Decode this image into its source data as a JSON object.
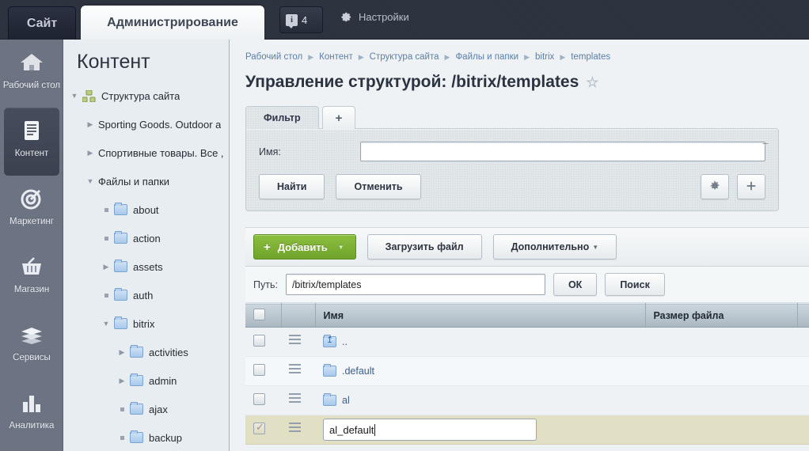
{
  "topbar": {
    "site_tab": "Сайт",
    "admin_tab": "Администрирование",
    "notifications_count": "4",
    "notifications_icon": "info-bubble-icon",
    "settings_label": "Настройки",
    "settings_icon": "gear-icon"
  },
  "rail": {
    "items": [
      {
        "label": "Рабочий стол",
        "icon": "home-icon",
        "active": false
      },
      {
        "label": "Контент",
        "icon": "document-icon",
        "active": true
      },
      {
        "label": "Маркетинг",
        "icon": "target-icon",
        "active": false
      },
      {
        "label": "Магазин",
        "icon": "basket-icon",
        "active": false
      },
      {
        "label": "Сервисы",
        "icon": "layers-icon",
        "active": false
      },
      {
        "label": "Аналитика",
        "icon": "bar-chart-icon",
        "active": false
      }
    ]
  },
  "tree": {
    "title": "Контент",
    "nodes": [
      {
        "label": "Структура сайта",
        "twist": "▼",
        "type": "sitemap",
        "indent": 0
      },
      {
        "label": "Sporting Goods. Outdoor a",
        "twist": "▶",
        "type": "none",
        "indent": 1
      },
      {
        "label": "Спортивные товары. Все ,",
        "twist": "▶",
        "type": "none",
        "indent": 1
      },
      {
        "label": "Файлы и папки",
        "twist": "▼",
        "type": "none",
        "indent": 1
      },
      {
        "label": "about",
        "twist": "bullet",
        "type": "folder",
        "indent": 2
      },
      {
        "label": "action",
        "twist": "bullet",
        "type": "folder",
        "indent": 2
      },
      {
        "label": "assets",
        "twist": "▶",
        "type": "folder",
        "indent": 2
      },
      {
        "label": "auth",
        "twist": "bullet",
        "type": "folder",
        "indent": 2
      },
      {
        "label": "bitrix",
        "twist": "▼",
        "type": "folder",
        "indent": 2
      },
      {
        "label": "activities",
        "twist": "▶",
        "type": "folder",
        "indent": 3
      },
      {
        "label": "admin",
        "twist": "▶",
        "type": "folder",
        "indent": 3
      },
      {
        "label": "ajax",
        "twist": "bullet",
        "type": "folder",
        "indent": 3
      },
      {
        "label": "backup",
        "twist": "bullet",
        "type": "folder",
        "indent": 3
      }
    ]
  },
  "breadcrumb": {
    "items": [
      "Рабочий стол",
      "Контент",
      "Структура сайта",
      "Файлы и папки",
      "bitrix",
      "templates"
    ],
    "separator": "▶"
  },
  "page": {
    "title": "Управление структурой: /bitrix/templates",
    "star_icon": "star-outline-icon"
  },
  "filter": {
    "tab_label": "Фильтр",
    "add_tab_label": "+",
    "collapse_label": "−",
    "name_label": "Имя:",
    "name_value": "",
    "find_button": "Найти",
    "cancel_button": "Отменить",
    "settings_icon": "gear-icon",
    "add_icon": "plus-icon"
  },
  "toolbar": {
    "add_label": "Добавить",
    "add_plus": "+",
    "upload_label": "Загрузить файл",
    "more_label": "Дополнительно",
    "caret": "▼"
  },
  "pathbar": {
    "label": "Путь:",
    "value": "/bitrix/templates",
    "ok_button": "ОК",
    "search_button": "Поиск"
  },
  "table": {
    "columns": [
      "",
      "",
      "Имя",
      "Размер файла"
    ],
    "rows": [
      {
        "name": "..",
        "icon": "folder-up-icon",
        "size": "",
        "checked": false,
        "editing": false,
        "alt": false
      },
      {
        "name": ".default",
        "icon": "folder-icon",
        "size": "",
        "checked": false,
        "editing": false,
        "alt": true
      },
      {
        "name": "al",
        "icon": "folder-icon",
        "size": "",
        "checked": false,
        "editing": false,
        "alt": false
      },
      {
        "name": "al_default",
        "icon": "",
        "size": "",
        "checked": true,
        "editing": true,
        "alt": false
      }
    ]
  },
  "colors": {
    "accent_green": "#7fb335",
    "selected_row": "#e2e0c4",
    "link_blue": "#3b5e8c",
    "topbar_dark": "#2c323e"
  }
}
